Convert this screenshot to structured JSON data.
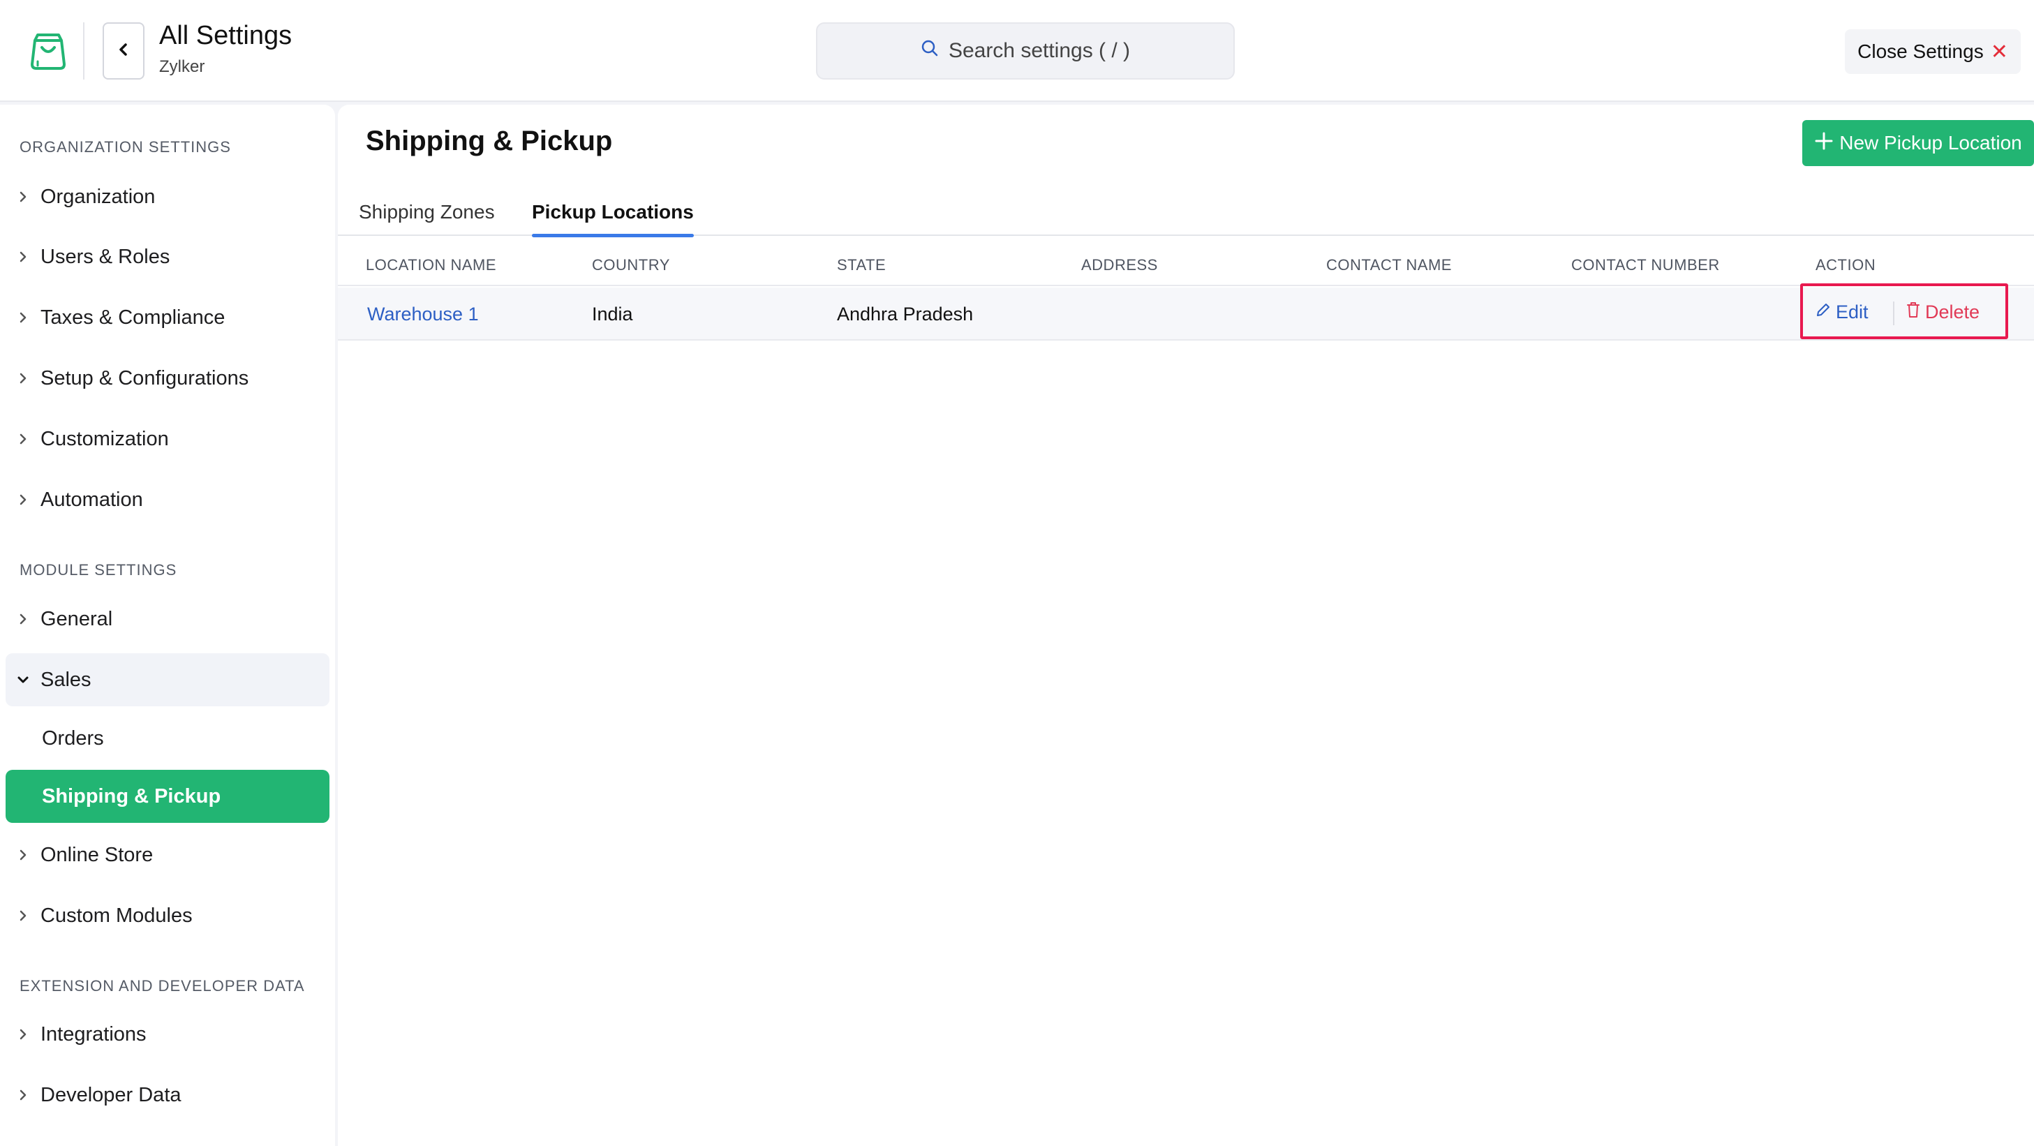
{
  "header": {
    "title": "All Settings",
    "org": "Zylker",
    "search_placeholder": "Search settings ( / )",
    "close_label": "Close Settings"
  },
  "sidebar": {
    "sections": [
      {
        "title": "ORGANIZATION SETTINGS",
        "items": [
          "Organization",
          "Users & Roles",
          "Taxes & Compliance",
          "Setup & Configurations",
          "Customization",
          "Automation"
        ]
      },
      {
        "title": "MODULE SETTINGS",
        "items": [
          "General",
          "Sales",
          "Orders",
          "Shipping & Pickup",
          "Online Store",
          "Custom Modules"
        ]
      },
      {
        "title": "EXTENSION AND DEVELOPER DATA",
        "items": [
          "Integrations",
          "Developer Data"
        ]
      }
    ],
    "expanded_item": "Sales",
    "active_item": "Shipping & Pickup"
  },
  "main": {
    "title": "Shipping & Pickup",
    "new_button": "New Pickup Location",
    "tabs": [
      "Shipping Zones",
      "Pickup Locations"
    ],
    "active_tab": "Pickup Locations",
    "table": {
      "columns": [
        "LOCATION NAME",
        "COUNTRY",
        "STATE",
        "ADDRESS",
        "CONTACT NAME",
        "CONTACT NUMBER",
        "ACTION"
      ],
      "rows": [
        {
          "location_name": "Warehouse 1",
          "country": "India",
          "state": "Andhra Pradesh",
          "address": "",
          "contact_name": "",
          "contact_number": ""
        }
      ],
      "actions": {
        "edit": "Edit",
        "delete": "Delete"
      }
    }
  },
  "colors": {
    "accent_green": "#22b573",
    "link_blue": "#2d5fc4",
    "tab_underline": "#3a7ae8",
    "delete_red": "#e13a56",
    "highlight_box": "#e8194f",
    "close_x": "#e42d3a"
  }
}
